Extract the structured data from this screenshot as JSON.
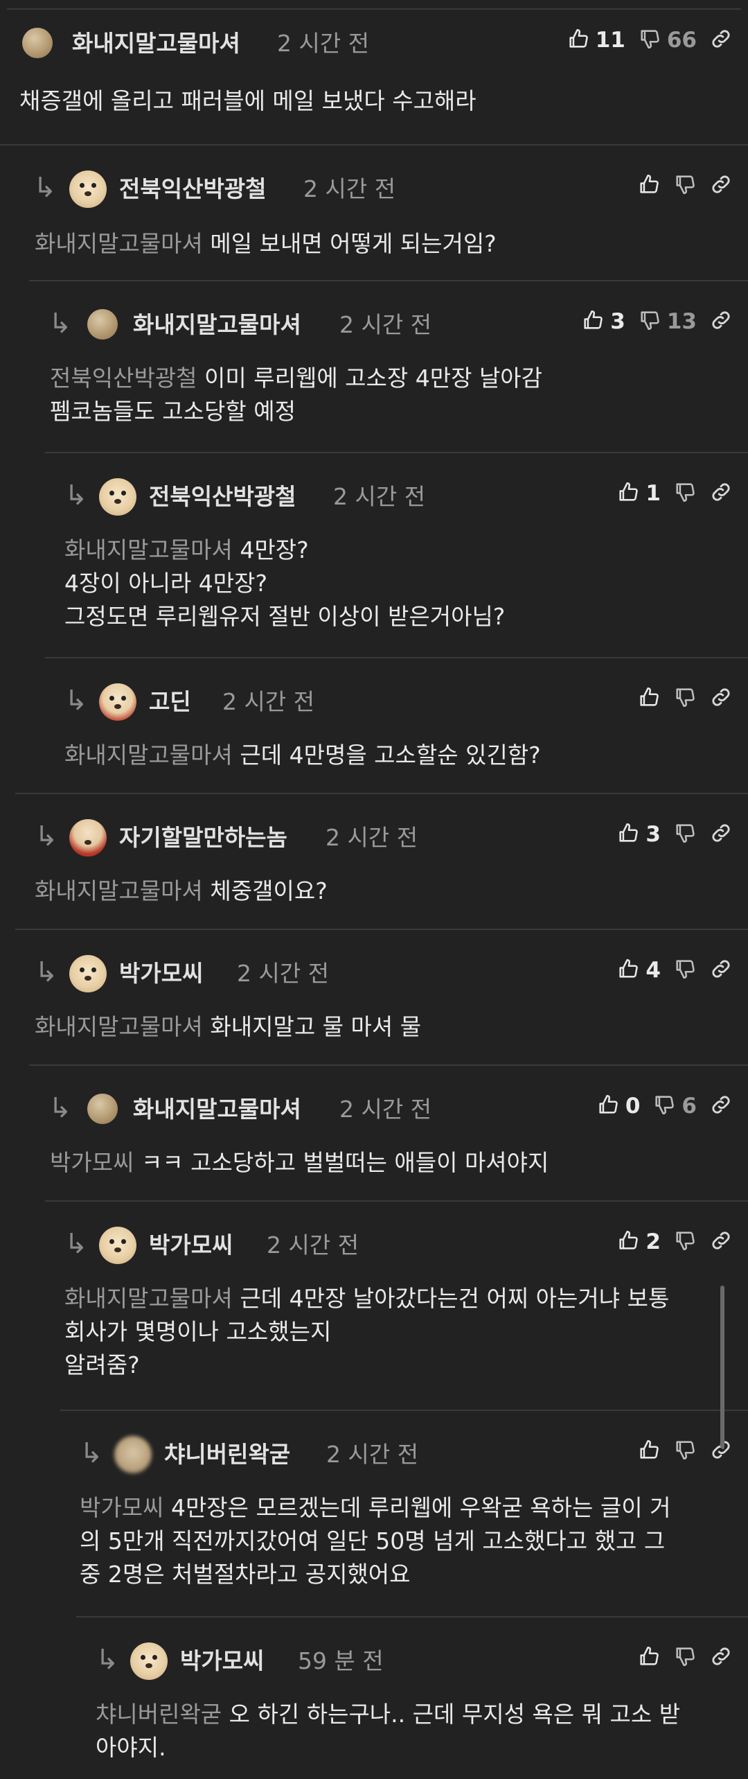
{
  "comments": [
    {
      "nick": "화내지말고물마셔",
      "time": "2 시간 전",
      "up": "11",
      "down": "66",
      "mention": "",
      "text": [
        "채증갤에 올리고 패러블에 메일 보냈다 수고해라"
      ],
      "avatar": "ball"
    },
    {
      "nick": "전북익산박광철",
      "time": "2 시간 전",
      "up": "",
      "down": "",
      "mention": "화내지말고물마셔",
      "text": [
        "메일 보내면 어떻게 되는거임?"
      ],
      "avatar": "dog"
    },
    {
      "nick": "화내지말고물마셔",
      "time": "2 시간 전",
      "up": "3",
      "down": "13",
      "mention": "전북익산박광철",
      "text": [
        "이미 루리웹에 고소장 4만장 날아감",
        "펨코놈들도 고소당할 예정"
      ],
      "avatar": "ball"
    },
    {
      "nick": "전북익산박광철",
      "time": "2 시간 전",
      "up": "1",
      "down": "",
      "mention": "화내지말고물마셔",
      "text": [
        "4만장?",
        "4장이 아니라 4만장?",
        "그정도면 루리웹유저 절반 이상이 받은거아님?"
      ],
      "avatar": "dog"
    },
    {
      "nick": "고딘",
      "time": "2 시간 전",
      "up": "",
      "down": "",
      "mention": "화내지말고물마셔",
      "text": [
        "근데 4만명을 고소할순 있긴함?"
      ],
      "avatar": "dogred"
    },
    {
      "nick": "자기할말만하는놈",
      "time": "2 시간 전",
      "up": "3",
      "down": "",
      "mention": "화내지말고물마셔",
      "text": [
        "체중갤이요?"
      ],
      "avatar": "red"
    },
    {
      "nick": "박가모씨",
      "time": "2 시간 전",
      "up": "4",
      "down": "",
      "mention": "화내지말고물마셔",
      "text": [
        "화내지말고 물 마셔 물"
      ],
      "avatar": "dog"
    },
    {
      "nick": "화내지말고물마셔",
      "time": "2 시간 전",
      "up": "0",
      "down": "6",
      "mention": "박가모씨",
      "text": [
        "ㅋㅋ 고소당하고 벌벌떠는 애들이 마셔야지"
      ],
      "avatar": "ball"
    },
    {
      "nick": "박가모씨",
      "time": "2 시간 전",
      "up": "2",
      "down": "",
      "mention": "화내지말고물마셔",
      "text": [
        "근데 4만장 날아갔다는건 어찌 아는거냐 보통",
        "회사가 몇명이나 고소했는지",
        "알려줌?"
      ],
      "avatar": "dog"
    },
    {
      "nick": "챠니버린왁굳",
      "time": "2 시간 전",
      "up": "",
      "down": "",
      "mention": "박가모씨",
      "text": [
        "4만장은 모르겠는데 루리웹에 우왁굳 욕하는 글이 거",
        "의 5만개 직전까지갔어여 일단 50명 넘게 고소했다고 했고 그",
        "중 2명은 처벌절차라고 공지했어요"
      ],
      "avatar": "blur"
    },
    {
      "nick": "박가모씨",
      "time": "59 분 전",
      "up": "",
      "down": "",
      "mention": "챠니버린왁굳",
      "text": [
        "오 하긴 하는구나.. 근데 무지성 욕은 뭐 고소 받",
        "아야지."
      ],
      "avatar": "dog"
    }
  ],
  "colors": {
    "background": "#222222",
    "divider": "#3a3a3a",
    "text": "#eaeaea",
    "muted": "#9a9a9a"
  },
  "icons": {
    "up": "thumbs-up-icon",
    "down": "thumbs-down-icon",
    "link": "link-icon",
    "reply": "reply-arrow-icon"
  }
}
